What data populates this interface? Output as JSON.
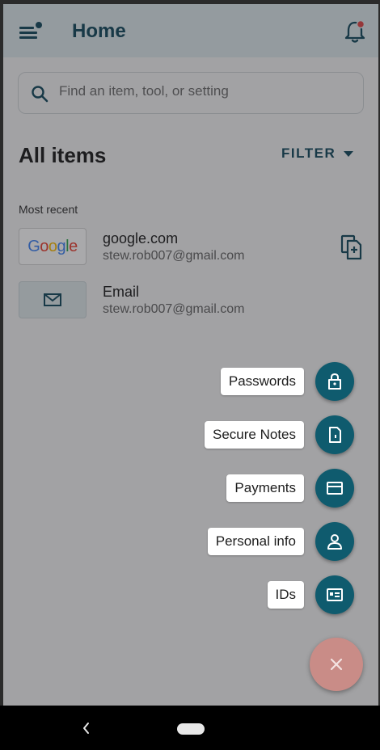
{
  "header": {
    "title": "Home"
  },
  "search": {
    "placeholder": "Find an item, tool, or setting"
  },
  "list": {
    "heading": "All items",
    "filter_label": "FILTER",
    "section_label": "Most recent",
    "items": [
      {
        "logo": "Google",
        "title": "google.com",
        "subtitle": "stew.rob007@gmail.com"
      },
      {
        "logo": "envelope-icon",
        "title": "Email",
        "subtitle": "stew.rob007@gmail.com"
      }
    ]
  },
  "fab_menu": {
    "items": [
      {
        "label": "Passwords",
        "icon": "password-lock-icon"
      },
      {
        "label": "Secure Notes",
        "icon": "note-icon"
      },
      {
        "label": "Payments",
        "icon": "card-icon"
      },
      {
        "label": "Personal info",
        "icon": "person-icon"
      },
      {
        "label": "IDs",
        "icon": "id-card-icon"
      }
    ],
    "close_icon": "close-icon"
  },
  "colors": {
    "primary": "#154b5e",
    "fab_mini": "#0f5b6e",
    "fab_main": "#c98c87",
    "appbar": "#dde8ec"
  }
}
